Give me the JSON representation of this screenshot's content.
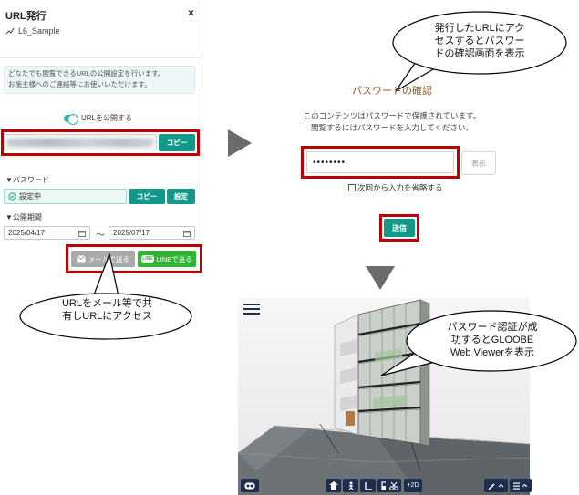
{
  "panel": {
    "title": "URL発行",
    "close": "×",
    "project_name": "L6_Sample",
    "info_line1": "どなたでも閲覧できるURLの公開設定を行います。",
    "info_line2": "お施主様へのご連絡等にお使いいただけます。",
    "publish_toggle_label": "URLを公開する",
    "copy_url_button": "コピー",
    "password_section_label": "▼パスワード",
    "password_status": "設定中",
    "copy_password_button": "コピー",
    "settings_button": "設定",
    "period_section_label": "▼公開期間",
    "start_date": "2025/04/17",
    "range_separator": "～",
    "end_date": "2025/07/17",
    "send_mail_button": "メールで送る",
    "send_line_button": "LINEで送る",
    "line_badge": "LINE"
  },
  "callouts": {
    "left": [
      "URLをメール等で共",
      "有しURLにアクセス"
    ],
    "top_right": [
      "発行したURLにアク",
      "セスするとパスワー",
      "ドの確認画面を表示"
    ],
    "viewer": [
      "パスワード認証が成",
      "功するとGLOOBE",
      "Web Viewerを表示"
    ]
  },
  "password_screen": {
    "title": "パスワードの確認",
    "desc_line1": "このコンテンツはパスワードで保護されています。",
    "desc_line2": "閲覧するにはパスワードを入力してください。",
    "password_value": "••••••••",
    "show_button": "表示",
    "skip_checkbox_label": "次回から入力を省略する",
    "submit_button": "送信"
  },
  "viewer": {
    "toolbar_2d_label": "+2D"
  },
  "colors": {
    "teal": "#13998a",
    "highlight_red": "#c00000",
    "line_green": "#2fb531",
    "toolbar_navy": "#1f2d4d",
    "title_brown": "#8a5a2b"
  }
}
